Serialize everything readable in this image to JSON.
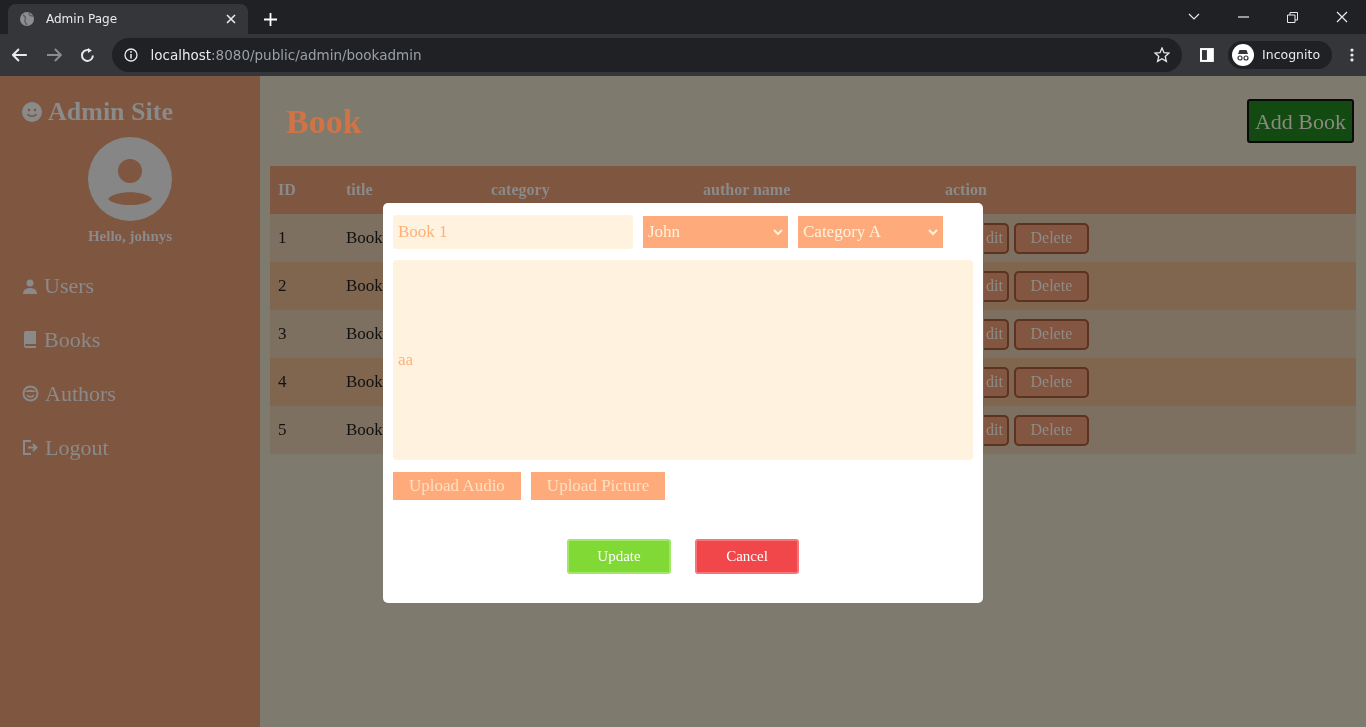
{
  "browser": {
    "tab_title": "Admin Page",
    "url_host": "localhost",
    "url_rest": ":8080/public/admin/bookadmin",
    "profile_label": "Incognito"
  },
  "sidebar": {
    "title": "Admin Site",
    "greeting": "Hello, johnys",
    "items": [
      {
        "label": "Users",
        "kind": "person"
      },
      {
        "label": "Books",
        "kind": "book"
      },
      {
        "label": "Authors",
        "kind": "face"
      },
      {
        "label": "Logout",
        "kind": "exit"
      }
    ]
  },
  "page": {
    "heading": "Book",
    "add_button": "Add Book"
  },
  "table": {
    "columns": [
      "ID",
      "title",
      "category",
      "author name",
      "action"
    ],
    "rows": [
      {
        "id": "1",
        "title": "Book",
        "edit": "dit",
        "delete": "Delete"
      },
      {
        "id": "2",
        "title": "Book",
        "edit": "dit",
        "delete": "Delete"
      },
      {
        "id": "3",
        "title": "Book",
        "edit": "dit",
        "delete": "Delete"
      },
      {
        "id": "4",
        "title": "Book",
        "edit": "dit",
        "delete": "Delete"
      },
      {
        "id": "5",
        "title": "Book",
        "edit": "dit",
        "delete": "Delete"
      }
    ]
  },
  "modal": {
    "title_field": {
      "value": "Book 1"
    },
    "author_select": {
      "value": "John"
    },
    "category_select": {
      "value": "Category A"
    },
    "description": {
      "value": "aa"
    },
    "upload_buttons": [
      "Upload Audio",
      "Upload Picture"
    ],
    "update_button": "Update",
    "cancel_button": "Cancel"
  }
}
